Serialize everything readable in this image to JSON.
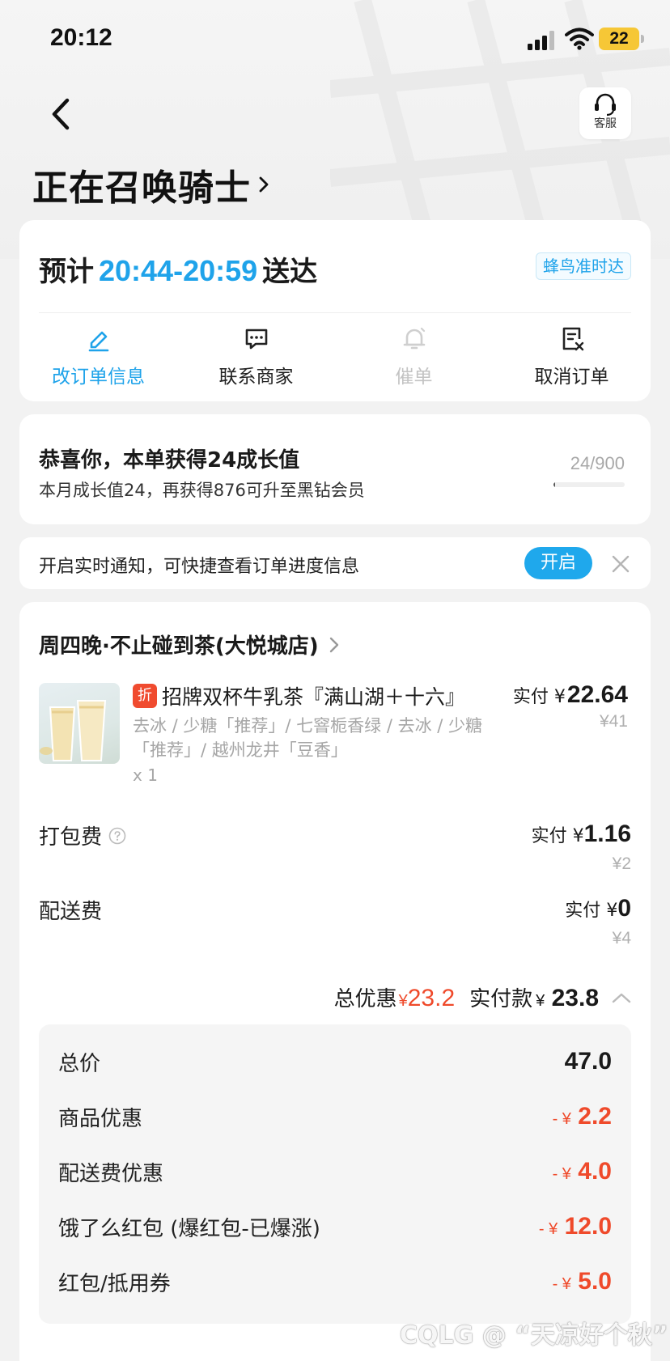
{
  "status_bar": {
    "time": "20:12",
    "battery": "22"
  },
  "header": {
    "service_label": "客服",
    "title": "正在召唤骑士"
  },
  "delivery": {
    "eta_prefix": "预计",
    "eta_time": "20:44-20:59",
    "eta_suffix": "送达",
    "badge": "蜂鸟准时达",
    "actions": [
      {
        "label": "改订单信息",
        "icon": "edit-icon",
        "state": "active"
      },
      {
        "label": "联系商家",
        "icon": "chat-icon",
        "state": "normal"
      },
      {
        "label": "催单",
        "icon": "bell-icon",
        "state": "disabled"
      },
      {
        "label": "取消订单",
        "icon": "cancel-order-icon",
        "state": "normal"
      }
    ]
  },
  "growth": {
    "title": "恭喜你，本单获得24成长值",
    "subtitle": "本月成长值24，再获得876可升至黑钻会员",
    "count": "24/900",
    "progress": 0.0267
  },
  "notify": {
    "text": "开启实时通知，可快捷查看订单进度信息",
    "button": "开启"
  },
  "order": {
    "shop_name": "周四晚·不止碰到茶(大悦城店)",
    "product": {
      "tag": "折",
      "name": "招牌双杯牛乳茶『满山湖＋十六』",
      "paid_label": "实付",
      "currency": "¥",
      "paid": "22.64",
      "original": "¥41",
      "spec": "去冰 / 少糖「推荐」/ 七窨栀香绿 / 去冰 / 少糖「推荐」/ 越州龙井「豆香」",
      "qty": "x 1"
    },
    "packing": {
      "label": "打包费",
      "paid_label": "实付",
      "currency": "¥",
      "paid": "1.16",
      "original": "¥2"
    },
    "delivery_fee": {
      "label": "配送费",
      "paid_label": "实付",
      "currency": "¥",
      "paid": "0",
      "original": "¥4"
    },
    "summary": {
      "discount_label": "总优惠",
      "currency": "¥",
      "discount": "23.2",
      "paid_label": "实付款",
      "paid": "23.8"
    },
    "breakdown": [
      {
        "label": "总价",
        "value": "47.0",
        "negative": false
      },
      {
        "label": "商品优惠",
        "value": "2.2",
        "negative": true
      },
      {
        "label": "配送费优惠",
        "value": "4.0",
        "negative": true
      },
      {
        "label": "饿了么红包 (爆红包-已爆涨)",
        "value": "12.0",
        "negative": true
      },
      {
        "label": "红包/抵用券",
        "value": "5.0",
        "negative": true
      }
    ],
    "neg_prefix": "- ¥"
  },
  "watermark": "CQLG @ “天凉好个秋”",
  "colors": {
    "accent": "#1fa3ea",
    "discount_red": "#ef4a2b",
    "background": "#f2f2f2"
  }
}
